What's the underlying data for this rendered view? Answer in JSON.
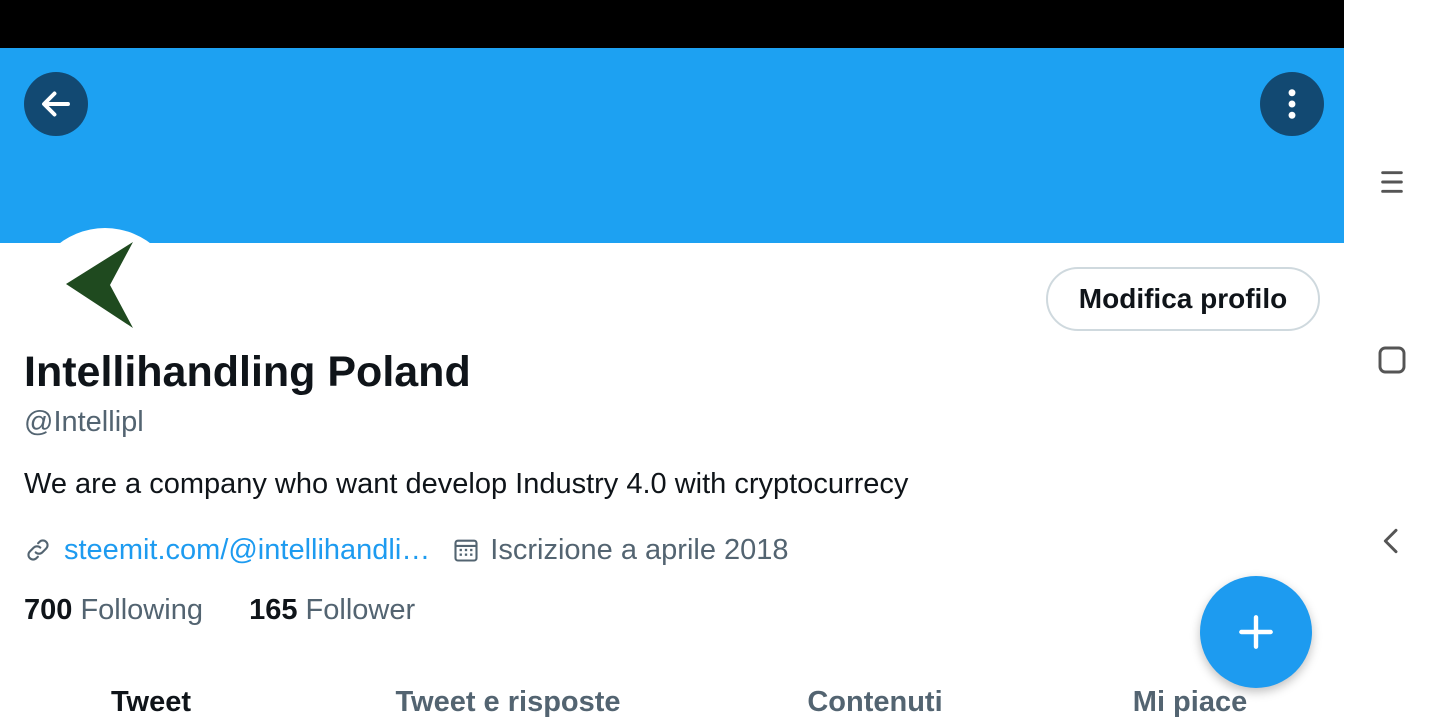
{
  "profile": {
    "name": "Intellihandling Poland",
    "handle": "@Intellipl",
    "bio": "We are a company who want develop Industry 4.0 with cryptocurrecy",
    "website": "steemit.com/@intellihandli…",
    "joined": "Iscrizione a aprile 2018",
    "edit_label": "Modifica profilo"
  },
  "stats": {
    "following_count": "700",
    "following_label": "Following",
    "followers_count": "165",
    "followers_label": "Follower"
  },
  "tabs": [
    {
      "label": "Tweet",
      "active": true
    },
    {
      "label": "Tweet e risposte",
      "active": false
    },
    {
      "label": "Contenuti",
      "active": false
    },
    {
      "label": "Mi piace",
      "active": false
    }
  ],
  "icons": {
    "back": "arrow-left-icon",
    "more": "more-vertical-icon",
    "link": "link-icon",
    "calendar": "calendar-icon",
    "compose": "plus-icon",
    "nav_recents": "menu-icon",
    "nav_home": "square-icon",
    "nav_back": "chevron-left-icon"
  },
  "colors": {
    "banner": "#1da1f2",
    "accent": "#1d9bf0",
    "text_primary": "#0f1419",
    "text_secondary": "#536471"
  }
}
